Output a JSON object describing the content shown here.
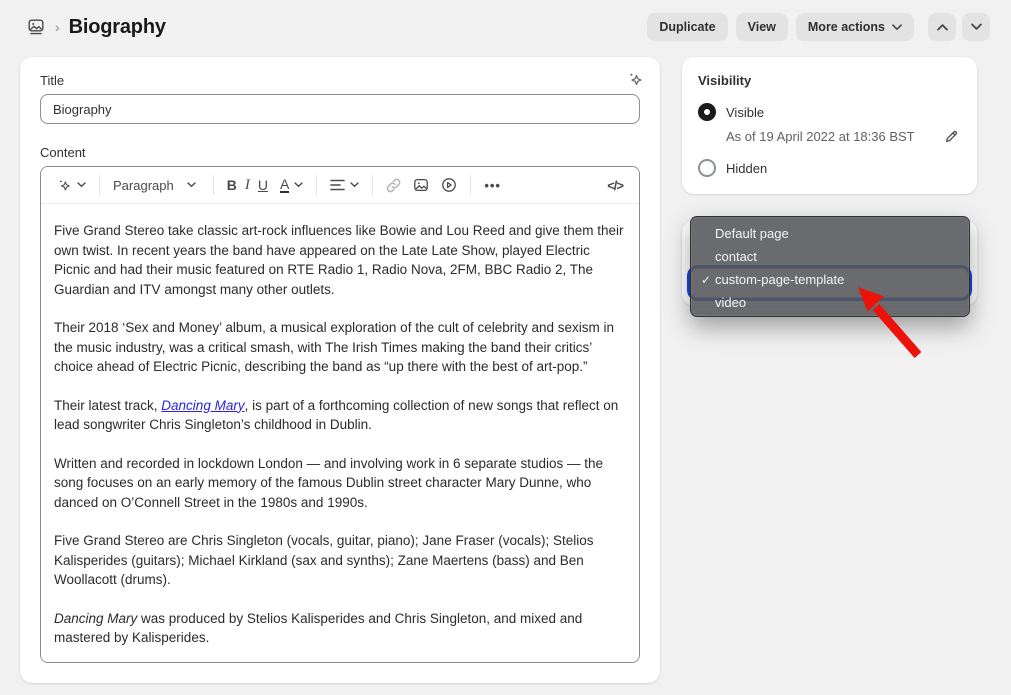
{
  "header": {
    "breadcrumb_title": "Biography",
    "duplicate_label": "Duplicate",
    "view_label": "View",
    "more_actions_label": "More actions"
  },
  "editor_panel": {
    "title_label": "Title",
    "title_value": "Biography",
    "content_label": "Content",
    "toolbar": {
      "paragraph_label": "Paragraph",
      "bold_label": "B",
      "italic_label": "I",
      "underline_label": "U",
      "color_label": "A",
      "more_label": "•••",
      "code_label": "</>"
    },
    "paragraphs": [
      {
        "segments": [
          {
            "style": "text",
            "text": "Five Grand Stereo take classic art-rock influences like Bowie and Lou Reed and give them their own twist. In recent years the band have appeared on the Late Late Show, played Electric Picnic and had their music featured on RTE Radio 1, Radio Nova, 2FM, BBC Radio 2, The Guardian and ITV amongst many other outlets."
          }
        ]
      },
      {
        "segments": [
          {
            "style": "text",
            "text": "Their 2018 ‘Sex and Money’ album, a musical exploration of the cult of celebrity and sexism in the music industry, was a critical smash, with The Irish Times making the band their critics’ choice ahead of Electric Picnic, describing the band as “up there with the best of art-pop.”"
          }
        ]
      },
      {
        "segments": [
          {
            "style": "text",
            "text": "Their latest track, "
          },
          {
            "style": "link",
            "text": "Dancing Mary"
          },
          {
            "style": "text",
            "text": ", is part of a forthcoming collection of new songs that reflect on lead songwriter Chris Singleton’s childhood in Dublin."
          }
        ]
      },
      {
        "segments": [
          {
            "style": "text",
            "text": "Written and recorded in lockdown London — and involving work in 6 separate studios — the song focuses on an early memory of the famous Dublin street character Mary Dunne, who danced on O’Connell Street in the 1980s and 1990s."
          }
        ]
      },
      {
        "segments": [
          {
            "style": "text",
            "text": "Five Grand Stereo are Chris Singleton (vocals, guitar, piano); Jane Fraser (vocals); Stelios Kalisperides (guitars); Michael Kirkland (sax and synths); Zane Maertens (bass) and Ben Woollacott (drums)."
          }
        ]
      },
      {
        "segments": [
          {
            "style": "italic",
            "text": "Dancing Mary"
          },
          {
            "style": "text",
            "text": " was produced by Stelios Kalisperides and Chris Singleton, and mixed and mastered by Kalisperides."
          }
        ]
      }
    ]
  },
  "sidebar": {
    "visibility": {
      "heading": "Visibility",
      "options": [
        {
          "label": "Visible",
          "selected": true,
          "note": "As of 19 April 2022 at 18:36 BST"
        },
        {
          "label": "Hidden",
          "selected": false
        }
      ]
    }
  },
  "dropdown": {
    "items": [
      {
        "label": "Default page",
        "checked": false
      },
      {
        "label": "contact",
        "checked": false
      },
      {
        "label": "custom-page-template",
        "checked": true
      },
      {
        "label": "video",
        "checked": false
      }
    ],
    "check_glyph": "✓"
  },
  "colors": {
    "page_background": "#f1f1f1",
    "button_background": "#e3e3e3",
    "focus_ring_blue": "#1748d8",
    "annotation_red": "#eb120a",
    "link_blue": "#2626e0",
    "dropdown_background": "rgba(84,86,90,0.88)"
  }
}
